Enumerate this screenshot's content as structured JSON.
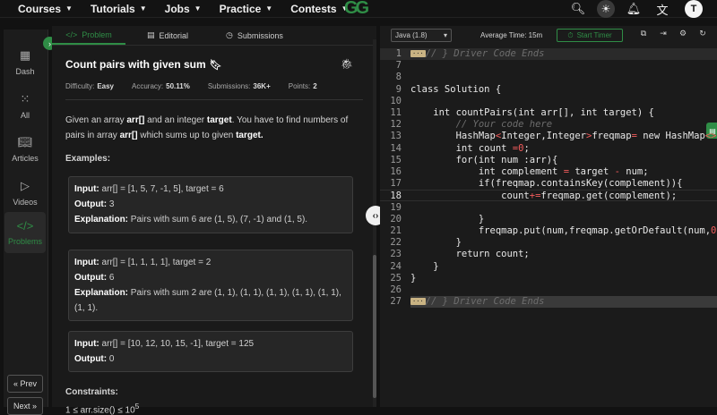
{
  "nav": {
    "items": [
      "Courses",
      "Tutorials",
      "Jobs",
      "Practice",
      "Contests"
    ],
    "logo": "GG",
    "avatar": "T"
  },
  "sidebar": {
    "items": [
      {
        "label": "Dash",
        "icon": "dashboard-icon"
      },
      {
        "label": "All",
        "icon": "grid-icon"
      },
      {
        "label": "Articles",
        "icon": "book-icon"
      },
      {
        "label": "Videos",
        "icon": "video-icon"
      },
      {
        "label": "Problems",
        "icon": "code-icon",
        "active": true
      }
    ],
    "prev": "« Prev",
    "next": "Next »"
  },
  "tabs": [
    {
      "label": "Problem",
      "icon": "</>",
      "active": true
    },
    {
      "label": "Editorial",
      "icon": "▤"
    },
    {
      "label": "Submissions",
      "icon": "◷"
    }
  ],
  "problem": {
    "title": "Count pairs with given sum",
    "difficulty_label": "Difficulty:",
    "difficulty": "Easy",
    "accuracy_label": "Accuracy:",
    "accuracy": "50.11%",
    "submissions_label": "Submissions:",
    "submissions": "36K+",
    "points_label": "Points:",
    "points": "2",
    "desc_1": "Given an array ",
    "desc_arr": "arr[]",
    "desc_2": " and an integer ",
    "desc_target": "target",
    "desc_3": ". You have to find numbers of pairs in array ",
    "desc_arr2": "arr[]",
    "desc_4": " which sums up to given ",
    "desc_target2": "target.",
    "examples_label": "Examples:",
    "examples": [
      {
        "input": "arr[] = [1, 5, 7, -1, 5], target = 6",
        "output": "3",
        "explanation": "Pairs with sum 6 are (1, 5), (7, -1) and (1, 5)."
      },
      {
        "input": "arr[] = [1, 1, 1, 1], target = 2",
        "output": "6",
        "explanation": "Pairs with sum 2 are (1, 1), (1, 1), (1, 1), (1, 1), (1, 1), (1, 1)."
      },
      {
        "input": "arr[] = [10, 12, 10, 15, -1], target = 125",
        "output": "0"
      }
    ],
    "input_label": "Input:",
    "output_label": "Output:",
    "explanation_label": "Explanation:",
    "constraints_label": "Constraints:",
    "constraint_1": "1 ≤ arr.size() ≤ 10",
    "constraint_1_exp": "5"
  },
  "editor": {
    "language": "Java (1.8)",
    "avg_time": "Average Time: 15m",
    "timer": "Start Timer",
    "lines": [
      {
        "n": "1",
        "html": "<span class='fold-box'>···</span><span class='cm'>// } Driver Code Ends</span>",
        "hl": true
      },
      {
        "n": "7",
        "html": ""
      },
      {
        "n": "8",
        "html": ""
      },
      {
        "n": "9",
        "html": "class Solution {"
      },
      {
        "n": "10",
        "html": ""
      },
      {
        "n": "11",
        "html": "    int countPairs(int arr[], int target) {"
      },
      {
        "n": "12",
        "html": "        <span class='cm'>// Your code here</span>"
      },
      {
        "n": "13",
        "html": "        HashMap<span class='op'>&lt;</span>Integer,Integer<span class='op'>&gt;</span>freqmap<span class='op'>=</span> new HashMap<span class='op'>&lt;&gt;</span>()"
      },
      {
        "n": "14",
        "html": "        int count <span class='op'>=</span><span class='num'>0</span>;"
      },
      {
        "n": "15",
        "html": "        for(int num :arr){"
      },
      {
        "n": "16",
        "html": "            int complement <span class='op'>=</span> target <span class='op'>-</span> num;"
      },
      {
        "n": "17",
        "html": "            if(freqmap.containsKey(complement)){"
      },
      {
        "n": "18",
        "html": "                count<span class='op'>+=</span>freqmap.get(complement);",
        "cur": true
      },
      {
        "n": "19",
        "html": ""
      },
      {
        "n": "20",
        "html": "            }"
      },
      {
        "n": "21",
        "html": "            freqmap.put(num,freqmap.getOrDefault(num,<span class='num'>0</span>)<span class='op'>+</span><span class='num'>1</span>);"
      },
      {
        "n": "22",
        "html": "        }"
      },
      {
        "n": "23",
        "html": "        return count;"
      },
      {
        "n": "24",
        "html": "    }"
      },
      {
        "n": "25",
        "html": "}"
      },
      {
        "n": "26",
        "html": ""
      },
      {
        "n": "27",
        "html": "<span class='fold-box'>···</span><span class='cm sel'>// } Driver Code Ends</span>",
        "sel": true
      }
    ]
  }
}
